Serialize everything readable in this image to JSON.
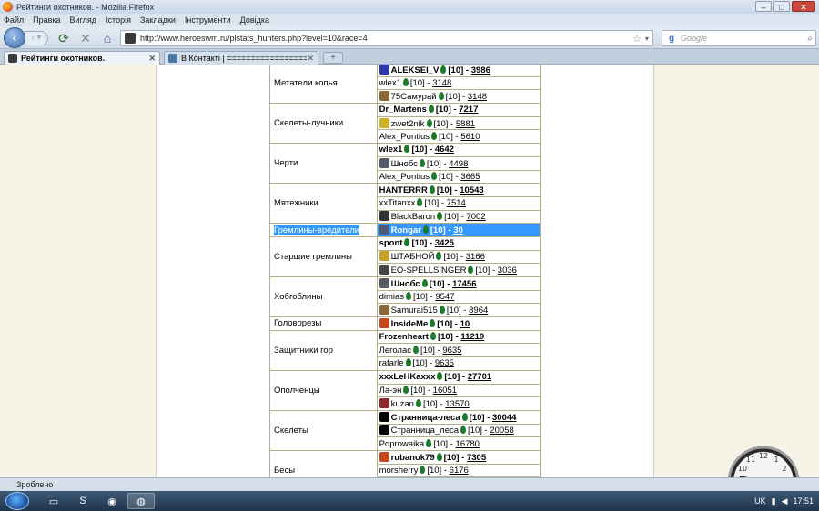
{
  "window": {
    "title": "Рейтинги охотников. - Mozilla Firefox"
  },
  "menu": [
    "Файл",
    "Правка",
    "Вигляд",
    "Історія",
    "Закладки",
    "Інструменти",
    "Довідка"
  ],
  "nav": {
    "url": "http://www.heroeswm.ru/plstats_hunters.php?level=10&race=4",
    "search_placeholder": "Google"
  },
  "tabs": [
    {
      "label": "Рейтинги охотников.",
      "active": true
    },
    {
      "label": "В Контакті | ===================="
    }
  ],
  "status": {
    "text": "Зроблено"
  },
  "taskbar": {
    "lang": "UK",
    "time": "17:51"
  },
  "table": {
    "rows": [
      {
        "category": "Метатели копья",
        "rowspan": 3,
        "name": "ALEKSEI_V",
        "level": "[10]",
        "score": "3986",
        "bold": true,
        "icon": "m-icon",
        "iconColor": "#2b3aa8"
      },
      {
        "name": "wlex1",
        "level": "[10]",
        "score": "3148"
      },
      {
        "name": "75Самурай",
        "level": "[10]",
        "score": "3148",
        "icon": "clan-icon",
        "iconColor": "#8a6a3a"
      },
      {
        "category": "Скелеты-лучники",
        "rowspan": 3,
        "name": "Dr_Martens",
        "level": "[10]",
        "score": "7217",
        "bold": true
      },
      {
        "name": "zwet2nik",
        "level": "[10]",
        "score": "5881",
        "icon": "clan-icon",
        "iconColor": "#c9b12a"
      },
      {
        "name": "Alex_Pontius",
        "level": "[10]",
        "score": "5610"
      },
      {
        "category": "Черти",
        "rowspan": 3,
        "name": "wlex1",
        "level": "[10]",
        "score": "4642",
        "bold": true
      },
      {
        "name": "Шнобс",
        "level": "[10]",
        "score": "4498",
        "icon": "clan-icon",
        "iconColor": "#555b66"
      },
      {
        "name": "Alex_Pontius",
        "level": "[10]",
        "score": "3665"
      },
      {
        "category": "Мятежники",
        "rowspan": 3,
        "name": "HANTERRR",
        "level": "[10]",
        "score": "10543",
        "bold": true
      },
      {
        "name": "xxTitanxx",
        "level": "[10]",
        "score": "7514"
      },
      {
        "name": "BlackBaron",
        "level": "[10]",
        "score": "7002",
        "icon": "clan-icon",
        "iconColor": "#333333"
      },
      {
        "category": "Гремлины-вредители",
        "rowspan": 1,
        "name": "Rongar",
        "level": "[10]",
        "score": "30",
        "bold": true,
        "selected": true,
        "icon": "clan-icon",
        "iconColor": "#4a5a78"
      },
      {
        "category": "Старшие гремлины",
        "rowspan": 3,
        "name": "spont",
        "level": "[10]",
        "score": "3425",
        "bold": true
      },
      {
        "name": "ШТАБНОЙ",
        "level": "[10]",
        "score": "3166",
        "icon": "clan-icon",
        "iconColor": "#c4a32a"
      },
      {
        "name": "EO-SPELLSINGER",
        "level": "[10]",
        "score": "3036",
        "icon": "clan-icon",
        "iconColor": "#444444"
      },
      {
        "category": "Хобгоблины",
        "rowspan": 3,
        "name": "Шнобс",
        "level": "[10]",
        "score": "17456",
        "bold": true,
        "icon": "clan-icon",
        "iconColor": "#555b66"
      },
      {
        "name": "dimias",
        "level": "[10]",
        "score": "9547"
      },
      {
        "name": "Samurai515",
        "level": "[10]",
        "score": "8964",
        "icon": "clan-icon",
        "iconColor": "#8a6a3a"
      },
      {
        "category": "Головорезы",
        "rowspan": 1,
        "name": "InsideMe",
        "level": "[10]",
        "score": "10",
        "bold": true,
        "icon": "clan-icon",
        "iconColor": "#c24a1e"
      },
      {
        "category": "Защитники гор",
        "rowspan": 3,
        "name": "Frozenheart",
        "level": "[10]",
        "score": "11219",
        "bold": true
      },
      {
        "name": "Леголас",
        "level": "[10]",
        "score": "9635"
      },
      {
        "name": "rafarle",
        "level": "[10]",
        "score": "9635"
      },
      {
        "category": "Ополченцы",
        "rowspan": 3,
        "name": "xxxLeHKaxxx",
        "level": "[10]",
        "score": "27701",
        "bold": true
      },
      {
        "name": "Ла-эн",
        "level": "[10]",
        "score": "16051"
      },
      {
        "name": "kuzan",
        "level": "[10]",
        "score": "13570",
        "icon": "clan-icon",
        "iconColor": "#8a2a2a"
      },
      {
        "category": "Скелеты",
        "rowspan": 3,
        "name": "Странница-леса",
        "level": "[10]",
        "score": "30044",
        "bold": true,
        "icon": "yin-yang-icon",
        "iconColor": "#000000"
      },
      {
        "name": "Странница_леса",
        "level": "[10]",
        "score": "20058",
        "icon": "yin-yang-icon",
        "iconColor": "#000000"
      },
      {
        "name": "Poprowaika",
        "level": "[10]",
        "score": "16780"
      },
      {
        "category": "Бесы",
        "rowspan": 3,
        "name": "rubanok79",
        "level": "[10]",
        "score": "7305",
        "bold": true,
        "icon": "clan-icon",
        "iconColor": "#c24a1e"
      },
      {
        "name": "morsherry",
        "level": "[10]",
        "score": "6176"
      },
      {
        "name": "",
        "level": "",
        "score": ""
      }
    ]
  }
}
